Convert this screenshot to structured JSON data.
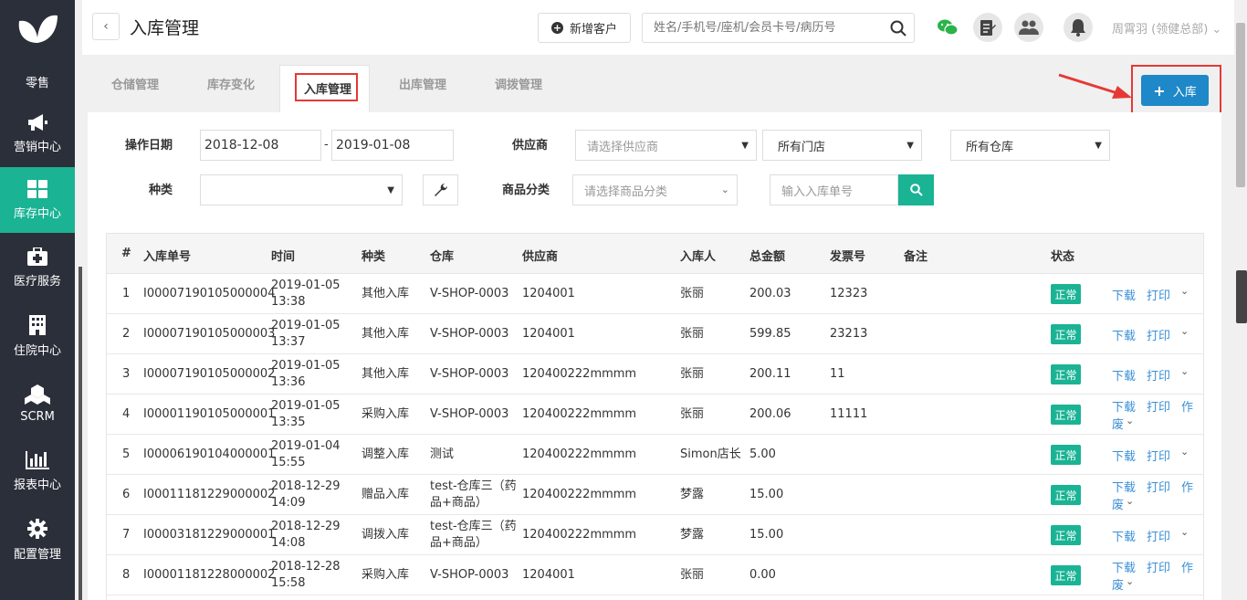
{
  "sidebar": {
    "items": [
      {
        "label": "零售",
        "icon": "butterfly-icon"
      },
      {
        "label": "营销中心",
        "icon": "megaphone-icon"
      },
      {
        "label": "库存中心",
        "icon": "grid-icon"
      },
      {
        "label": "医疗服务",
        "icon": "medkit-icon"
      },
      {
        "label": "住院中心",
        "icon": "building-icon"
      },
      {
        "label": "SCRM",
        "icon": "cubes-icon"
      },
      {
        "label": "报表中心",
        "icon": "bar-chart-icon"
      },
      {
        "label": "配置管理",
        "icon": "gear-icon"
      }
    ]
  },
  "header": {
    "back": "‹",
    "title": "入库管理",
    "new_customer": "新增客户",
    "search_placeholder": "姓名/手机号/座机/会员卡号/病历号",
    "user": "周霄羽 (领健总部)",
    "user_caret": "⌄"
  },
  "tabs": [
    "仓储管理",
    "库存变化",
    "入库管理",
    "出库管理",
    "调拨管理"
  ],
  "inbound_button": "入库",
  "filters": {
    "date_label": "操作日期",
    "date_from": "2018-12-08",
    "date_sep": "-",
    "date_to": "2019-01-08",
    "supplier_label": "供应商",
    "supplier_placeholder": "请选择供应商",
    "store_value": "所有门店",
    "warehouse_value": "所有仓库",
    "category_label": "种类",
    "category_value": "",
    "goods_category_label": "商品分类",
    "goods_category_placeholder": "请选择商品分类",
    "order_placeholder": "输入入库单号"
  },
  "table": {
    "columns": [
      "#",
      "入库单号",
      "时间",
      "种类",
      "仓库",
      "供应商",
      "入库人",
      "总金额",
      "发票号",
      "备注",
      "状态"
    ],
    "actions": {
      "download": "下载",
      "print": "打印",
      "void_a": "作",
      "void_b": "废",
      "chev": "⌄"
    },
    "rows": [
      {
        "no": "1",
        "id": "I00007190105000004",
        "date": "2019-01-05",
        "time": "13:38",
        "type": "其他入库",
        "wh": [
          "V-SHOP-0003"
        ],
        "supplier": "1204001",
        "person": "张丽",
        "amount": "200.03",
        "invoice": "12323",
        "note": "",
        "status": "正常",
        "void": false
      },
      {
        "no": "2",
        "id": "I00007190105000003",
        "date": "2019-01-05",
        "time": "13:37",
        "type": "其他入库",
        "wh": [
          "V-SHOP-0003"
        ],
        "supplier": "1204001",
        "person": "张丽",
        "amount": "599.85",
        "invoice": "23213",
        "note": "",
        "status": "正常",
        "void": false
      },
      {
        "no": "3",
        "id": "I00007190105000002",
        "date": "2019-01-05",
        "time": "13:36",
        "type": "其他入库",
        "wh": [
          "V-SHOP-0003"
        ],
        "supplier": "120400222mmmm",
        "person": "张丽",
        "amount": "200.11",
        "invoice": "11",
        "note": "",
        "status": "正常",
        "void": false
      },
      {
        "no": "4",
        "id": "I00001190105000001",
        "date": "2019-01-05",
        "time": "13:35",
        "type": "采购入库",
        "wh": [
          "V-SHOP-0003"
        ],
        "supplier": "120400222mmmm",
        "person": "张丽",
        "amount": "200.06",
        "invoice": "11111",
        "note": "",
        "status": "正常",
        "void": true
      },
      {
        "no": "5",
        "id": "I00006190104000001",
        "date": "2019-01-04",
        "time": "15:55",
        "type": "调整入库",
        "wh": [
          "测试"
        ],
        "supplier": "120400222mmmm",
        "person": "Simon店长",
        "amount": "5.00",
        "invoice": "",
        "note": "",
        "status": "正常",
        "void": false
      },
      {
        "no": "6",
        "id": "I00011181229000002",
        "date": "2018-12-29",
        "time": "14:09",
        "type": "赠品入库",
        "wh": [
          "test-仓库三（药",
          "品+商品）"
        ],
        "supplier": "120400222mmmm",
        "person": "梦露",
        "amount": "15.00",
        "invoice": "",
        "note": "",
        "status": "正常",
        "void": true
      },
      {
        "no": "7",
        "id": "I00003181229000001",
        "date": "2018-12-29",
        "time": "14:08",
        "type": "调拨入库",
        "wh": [
          "test-仓库三（药",
          "品+商品）"
        ],
        "supplier": "120400222mmmm",
        "person": "梦露",
        "amount": "15.00",
        "invoice": "",
        "note": "",
        "status": "正常",
        "void": false
      },
      {
        "no": "8",
        "id": "I00001181228000002",
        "date": "2018-12-28",
        "time": "15:58",
        "type": "采购入库",
        "wh": [
          "V-SHOP-0003"
        ],
        "supplier": "1204001",
        "person": "张丽",
        "amount": "0.00",
        "invoice": "",
        "note": "",
        "status": "正常",
        "void": true
      }
    ]
  },
  "colors": {
    "accent": "#1ab394",
    "sidebar": "#2b2f3a",
    "primary": "#1e88c8",
    "highlight": "#e53935",
    "link": "#3a8fd6"
  }
}
